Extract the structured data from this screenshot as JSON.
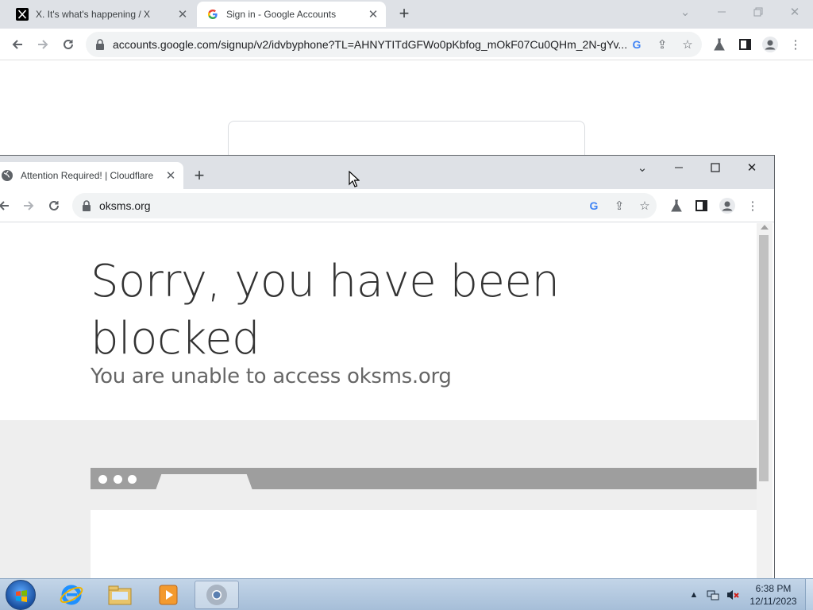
{
  "back_browser": {
    "tabs": [
      {
        "title": "X. It's what's happening / X",
        "icon": "x-logo-icon"
      },
      {
        "title": "Sign in - Google Accounts",
        "icon": "google-g-icon"
      }
    ],
    "url": "accounts.google.com/signup/v2/idvbyphone?TL=AHNYTITdGFWo0pKbfog_mOkF07Cu0QHm_2N-gYv..."
  },
  "front_browser": {
    "tab": {
      "title": "Attention Required! | Cloudflare",
      "icon": "globe-icon"
    },
    "url": "oksms.org",
    "page": {
      "headline": "Sorry, you have been blocked",
      "subheadline": "You are unable to access oksms.org"
    }
  },
  "taskbar": {
    "apps": [
      "internet-explorer",
      "windows-explorer",
      "media-player",
      "google-chrome"
    ],
    "clock_time": "6:38 PM",
    "clock_date": "12/11/2023"
  },
  "colors": {
    "tabstrip": "#dee1e6",
    "headline": "#333333",
    "subheadline": "#666666",
    "grey_band": "#eeeeee",
    "taskbar": "#b3c9e0"
  }
}
